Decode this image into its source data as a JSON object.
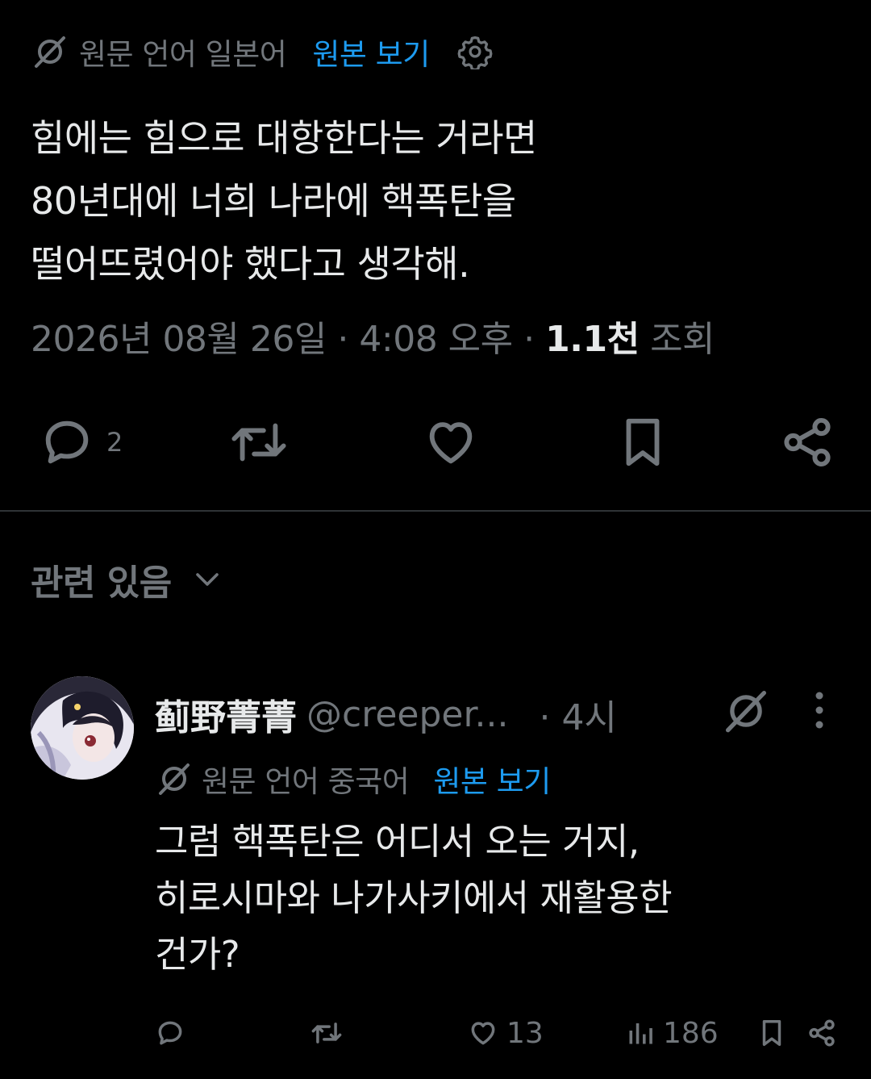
{
  "post": {
    "translation": {
      "label": "원문 언어 일본어",
      "show_original": "원본 보기",
      "icons": [
        "translate-off-icon",
        "gear-icon"
      ]
    },
    "text_lines": [
      "힘에는 힘으로 대항한다는 거라면",
      "80년대에 너희 나라에 핵폭탄을",
      "떨어뜨렸어야 했다고 생각해."
    ],
    "meta": {
      "date": "2026년 08월 26일",
      "time": "4:08 오후",
      "views_count": "1.1천",
      "views_label": "조회",
      "separator": "·"
    },
    "actions": {
      "reply_count": "2",
      "icons": [
        "reply-icon",
        "repost-icon",
        "like-icon",
        "bookmark-icon",
        "share-icon"
      ]
    }
  },
  "related": {
    "label": "관련 있음"
  },
  "reply": {
    "name": "蓟野菁菁",
    "handle": "@creeper...",
    "time": "· 4시",
    "translation": {
      "label": "원문 언어 중국어",
      "show_original": "원본 보기"
    },
    "text_lines": [
      "그럼 핵폭탄은 어디서 오는 거지,",
      "히로시마와 나가사키에서 재활용한",
      "건가?"
    ],
    "actions": {
      "reply_count": "",
      "repost_count": "",
      "like_count": "13",
      "view_count": "186"
    }
  },
  "colors": {
    "background": "#000000",
    "text": "#e7e9ea",
    "muted": "#71767b",
    "link": "#1d9bf0",
    "divider": "#2f3336"
  }
}
